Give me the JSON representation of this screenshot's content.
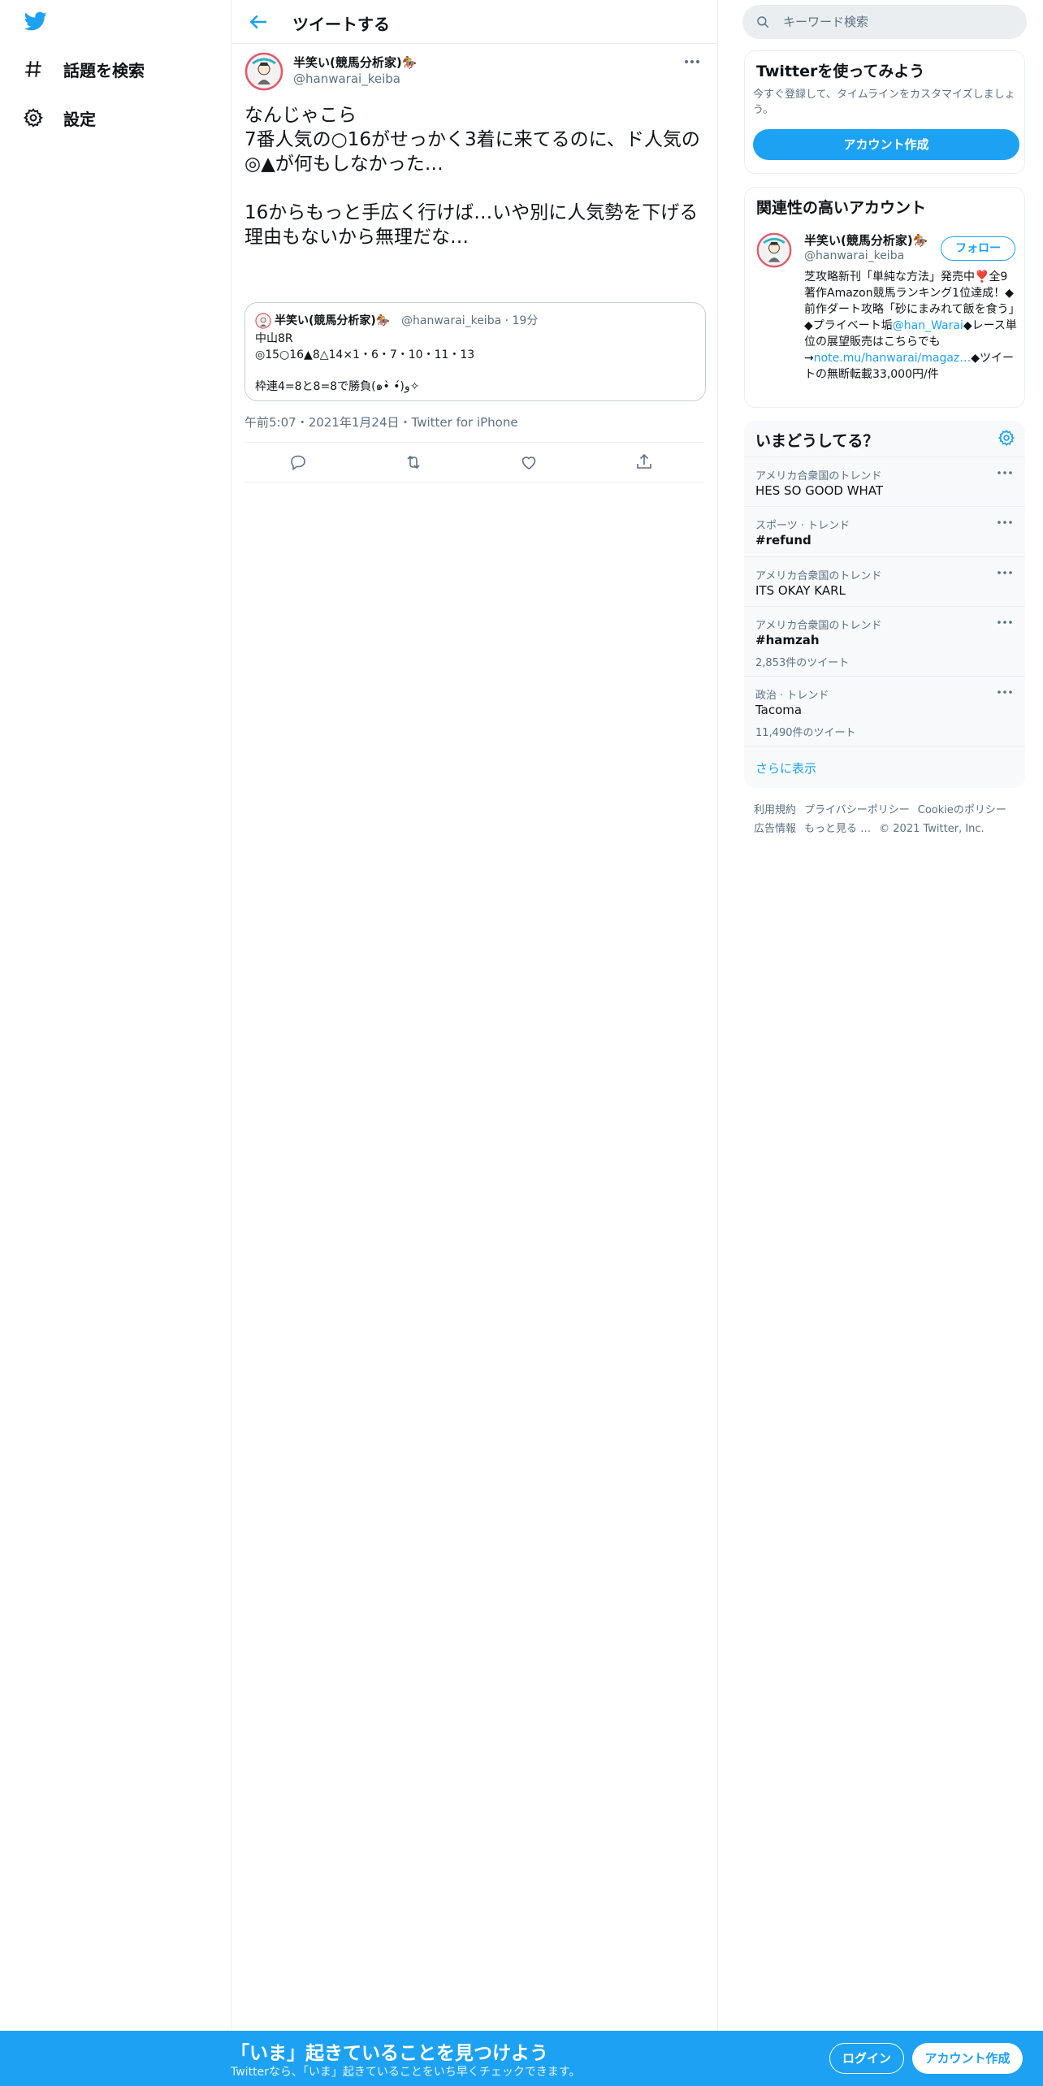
{
  "colors": {
    "accent": "#1da1f2",
    "text": "#0f1419",
    "muted": "#5b7083",
    "border": "#ebeef0"
  },
  "nav": {
    "logo_icon": "twitter-bird-icon",
    "items": [
      {
        "icon": "hashtag-icon",
        "label": "話題を検索"
      },
      {
        "icon": "gear-icon",
        "label": "設定"
      }
    ]
  },
  "header": {
    "title": "ツイートする",
    "back_icon": "arrow-left-icon"
  },
  "tweet": {
    "author_name": "半笑い(競馬分析家)🏇",
    "author_handle": "@hanwarai_keiba",
    "text": "なんじゃこら\n7番人気の○16がせっかく3着に来てるのに、ド人気の◎▲が何もしなかった…\n\n16からもっと手広く行けば…いや別に人気勢を下げる理由もないから無理だな…",
    "quote": {
      "author_name": "半笑い(競馬分析家)🏇",
      "author_handle_time": "@hanwarai_keiba · 19分",
      "text": "中山8R\n◎15○16▲8△14×1・6・7・10・11・13\n\n枠連4=8と8=8で勝負(๑•̀ •́)و✧"
    },
    "time": "午前5:07",
    "date": "2021年1月24日",
    "source": "Twitter for iPhone",
    "meta_sep": "・",
    "actions": [
      "reply-icon",
      "retweet-icon",
      "like-icon",
      "share-icon"
    ]
  },
  "search": {
    "placeholder": "キーワード検索"
  },
  "signup_card": {
    "title": "Twitterを使ってみよう",
    "description": "今すぐ登録して、タイムラインをカスタマイズしましょう。",
    "button": "アカウント作成"
  },
  "related": {
    "title": "関連性の高いアカウント",
    "name": "半笑い(競馬分析家)🏇",
    "handle": "@hanwarai_keiba",
    "follow": "フォロー",
    "bio_part1": "芝攻略新刊「単純な方法」発売中❣️全9著作Amazon競馬ランキング1位達成！◆前作ダート攻略「砂にまみれて飯を食う」◆プライベート垢",
    "bio_link1": "@han_Warai",
    "bio_part2": "◆レース単位の展望販売はこちらでも→",
    "bio_link2": "note.mu/hanwarai/magaz…",
    "bio_part3": "◆ツイートの無断転載33,000円/件"
  },
  "trends": {
    "title": "いまどうしてる？",
    "items": [
      {
        "category": "アメリカ合衆国のトレンド",
        "name": "HES SO GOOD WHAT",
        "count": ""
      },
      {
        "category": "スポーツ · トレンド",
        "name": "#refund",
        "count": ""
      },
      {
        "category": "アメリカ合衆国のトレンド",
        "name": "ITS OKAY KARL",
        "count": ""
      },
      {
        "category": "アメリカ合衆国のトレンド",
        "name": "#hamzah",
        "count": "2,853件のツイート"
      },
      {
        "category": "政治 · トレンド",
        "name": "Tacoma",
        "count": "11,490件のツイート"
      }
    ],
    "show_more": "さらに表示"
  },
  "footer": {
    "links": [
      "利用規約",
      "プライバシーポリシー",
      "Cookieのポリシー",
      "広告情報",
      "もっと見る …",
      "© 2021 Twitter, Inc."
    ]
  },
  "banner": {
    "title": "「いま」起きていることを見つけよう",
    "subtitle": "Twitterなら、「いま」起きていることをいち早くチェックできます。",
    "login": "ログイン",
    "signup": "アカウント作成"
  }
}
